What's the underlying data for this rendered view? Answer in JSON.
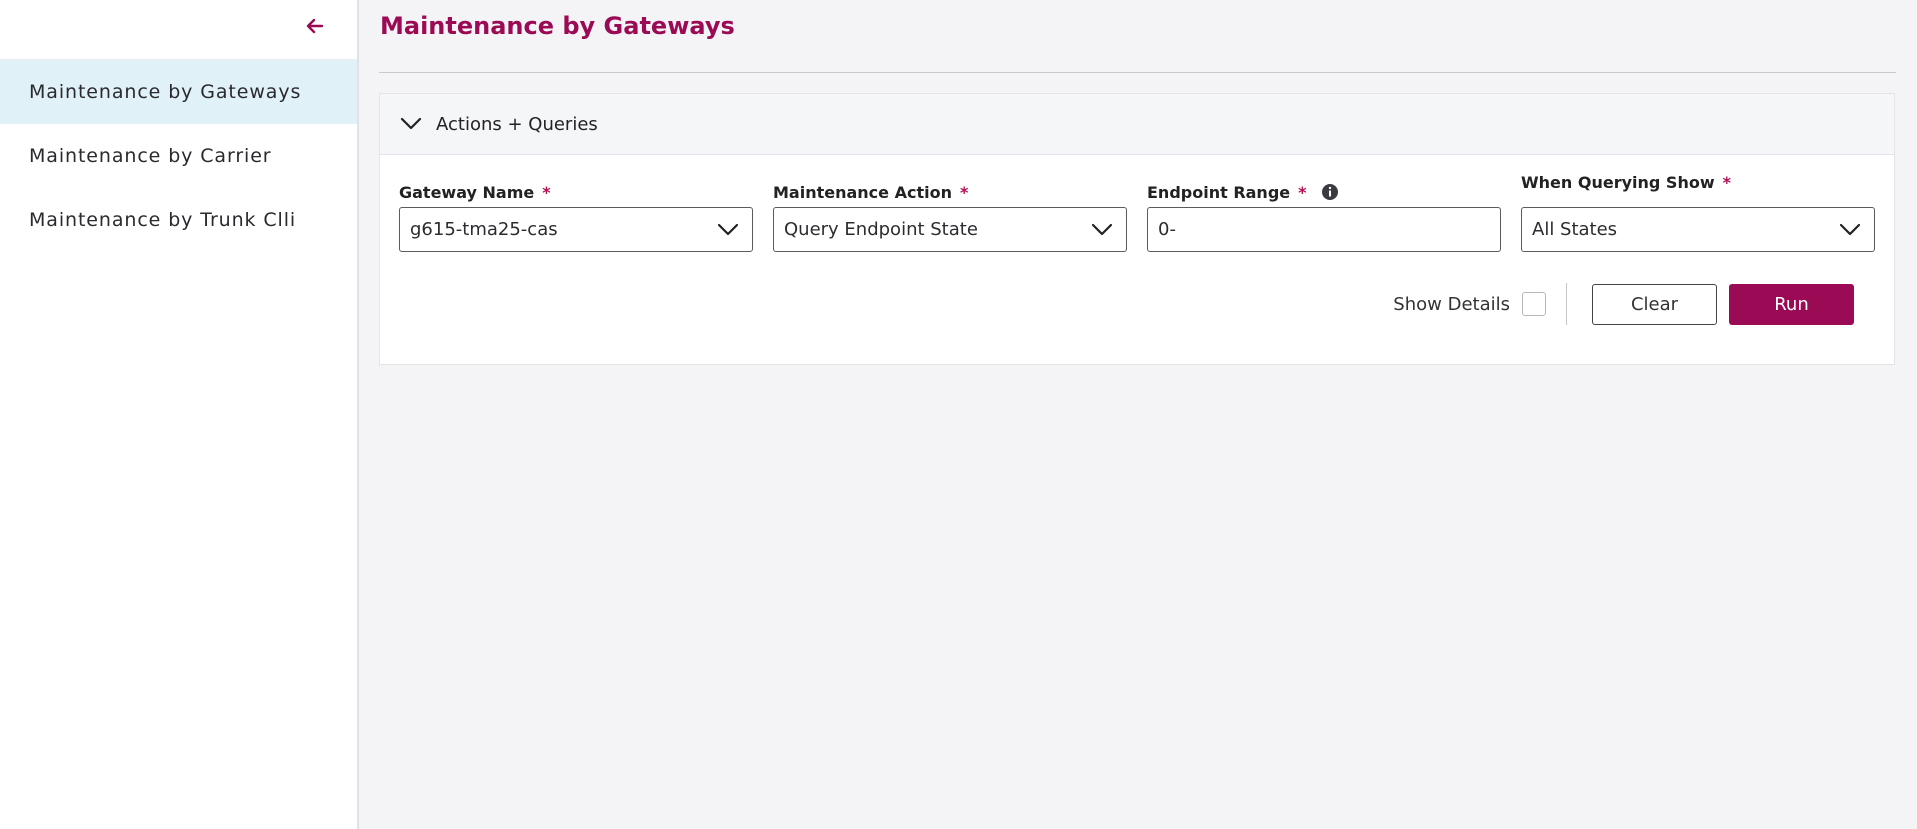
{
  "sidebar": {
    "collapse_icon": "arrow-left-icon",
    "items": [
      {
        "label": "Maintenance by Gateways",
        "active": true
      },
      {
        "label": "Maintenance by Carrier",
        "active": false
      },
      {
        "label": "Maintenance by Trunk Clli",
        "active": false
      }
    ]
  },
  "main": {
    "title": "Maintenance by Gateways",
    "panel": {
      "header_label": "Actions + Queries",
      "fields": {
        "gateway_name": {
          "label": "Gateway Name",
          "required_mark": "*",
          "value": "g615-tma25-cas"
        },
        "maintenance_action": {
          "label": "Maintenance Action",
          "required_mark": "*",
          "value": "Query Endpoint State"
        },
        "endpoint_range": {
          "label": "Endpoint Range",
          "required_mark": "*",
          "value": "0-",
          "info_icon": "info-circle-icon"
        },
        "when_querying_show": {
          "label": "When Querying Show",
          "required_mark": "*",
          "value": "All States"
        }
      },
      "show_details_label": "Show Details",
      "show_details_checked": false,
      "clear_label": "Clear",
      "run_label": "Run"
    }
  },
  "colors": {
    "brand": "#9b0a54",
    "active_nav_bg": "#e1f1f8",
    "page_bg": "#f4f4f6"
  }
}
